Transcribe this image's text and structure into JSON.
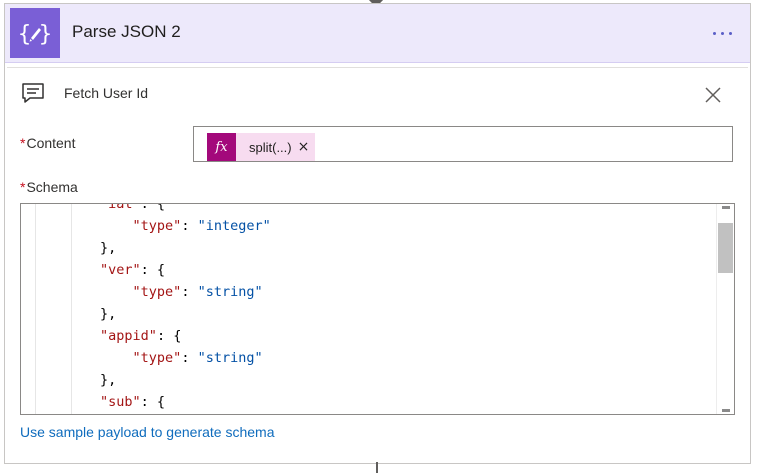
{
  "card": {
    "title": "Parse JSON 2",
    "icon": "json-braces-icon",
    "more_icon": "more-options-icon"
  },
  "comment": {
    "icon": "comment-icon",
    "text": "Fetch User Id",
    "close_icon": "close-icon"
  },
  "content": {
    "required_mark": "*",
    "label": "Content",
    "token": {
      "icon_text": "fx",
      "text": "split(...)",
      "remove": "×"
    }
  },
  "schema": {
    "required_mark": "*",
    "label": "Schema",
    "lines": [
      {
        "indent": "        ",
        "key": "\"iat\"",
        "rest": ": {"
      },
      {
        "indent": "            ",
        "key": "\"type\"",
        "sep": ": ",
        "val": "\"integer\""
      },
      {
        "indent": "        ",
        "rest": "},"
      },
      {
        "indent": "        ",
        "key": "\"ver\"",
        "rest": ": {"
      },
      {
        "indent": "            ",
        "key": "\"type\"",
        "sep": ": ",
        "val": "\"string\""
      },
      {
        "indent": "        ",
        "rest": "},"
      },
      {
        "indent": "        ",
        "key": "\"appid\"",
        "rest": ": {"
      },
      {
        "indent": "            ",
        "key": "\"type\"",
        "sep": ": ",
        "val": "\"string\""
      },
      {
        "indent": "        ",
        "rest": "},"
      },
      {
        "indent": "        ",
        "key": "\"sub\"",
        "rest": ": {"
      }
    ]
  },
  "footer": {
    "link": "Use sample payload to generate schema"
  },
  "colors": {
    "header_bg": "#ede9fb",
    "icon_bg": "#7a5fd6",
    "token_fx_bg": "#a3097b",
    "token_bg": "#f7dcf0",
    "link": "#0f6cbd",
    "required": "#c50f1f"
  }
}
